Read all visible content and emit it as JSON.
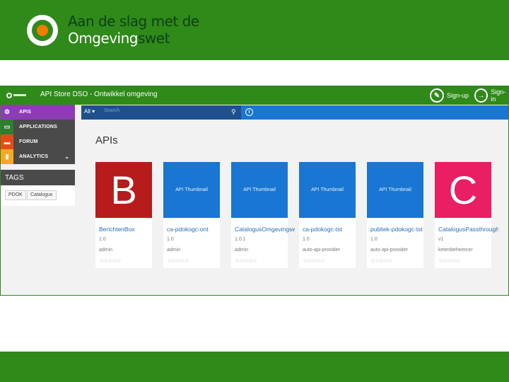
{
  "slide": {
    "title_line1": "Aan de slag met de",
    "title_line2_a": "Omgeving",
    "title_line2_b": "swet"
  },
  "app": {
    "window_title": "API Store DSO - Ontwikkel omgeving",
    "signup_label": "Sign-up",
    "signin_label": "Sign-in"
  },
  "sidebar": {
    "items": [
      {
        "label": "APIS",
        "icon": "gear-icon"
      },
      {
        "label": "APPLICATIONS",
        "icon": "window-icon"
      },
      {
        "label": "FORUM",
        "icon": "chat-icon"
      },
      {
        "label": "ANALYTICS",
        "icon": "bar-chart-icon"
      }
    ],
    "tags_title": "TAGS",
    "tags": [
      "PDOK",
      "Catalogus"
    ]
  },
  "search": {
    "scope": "All",
    "placeholder": "Search"
  },
  "main": {
    "title": "APIs",
    "cards": [
      {
        "thumb": "B",
        "thumb_kind": "letter",
        "color": "#b71c1c",
        "name": "BerichtenBox",
        "version": "1.0",
        "owner": "admin",
        "stars": "☆☆☆☆☆"
      },
      {
        "thumb": "API Thumbnail",
        "thumb_kind": "text",
        "color": "#1976d2",
        "name": "ca-pdokogc-ont",
        "version": "1.0",
        "owner": "admin",
        "stars": "☆☆☆☆☆"
      },
      {
        "thumb": "API Thumbnail",
        "thumb_kind": "text",
        "color": "#1976d2",
        "name": "CatalogusOmgevingswet",
        "version": "1.0.1",
        "owner": "admin",
        "stars": "☆☆☆☆☆"
      },
      {
        "thumb": "API Thumbnail",
        "thumb_kind": "text",
        "color": "#1976d2",
        "name": "ca-pdokogc-tst",
        "version": "1.0",
        "owner": "auto-api-provider",
        "stars": "☆☆☆☆☆"
      },
      {
        "thumb": "API Thumbnail",
        "thumb_kind": "text",
        "color": "#1976d2",
        "name": "publiek-pdokogc-tst",
        "version": "1.0",
        "owner": "auto-api-provider",
        "stars": "☆☆☆☆☆"
      },
      {
        "thumb": "C",
        "thumb_kind": "letter",
        "color": "#e91e63",
        "name": "CatalogusPassthrough",
        "version": "v1",
        "owner": "ketenbeheercer",
        "stars": "☆☆☆☆☆"
      }
    ]
  }
}
